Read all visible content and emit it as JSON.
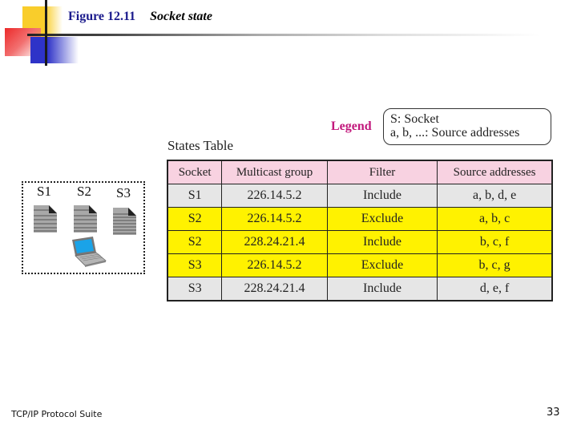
{
  "slide": {
    "figure_number": "Figure 12.11",
    "figure_caption": "Socket state"
  },
  "legend": {
    "label": "Legend",
    "lines": [
      "S: Socket",
      "a, b, ...: Source addresses"
    ]
  },
  "network": {
    "sockets": [
      "S1",
      "S2",
      "S3"
    ],
    "icons": [
      "document-icon",
      "document-icon",
      "document-icon",
      "laptop-icon"
    ]
  },
  "states_table": {
    "title": "States Table",
    "columns": [
      "Socket",
      "Multicast group",
      "Filter",
      "Source addresses"
    ],
    "rows": [
      {
        "socket": "S1",
        "group": "226.14.5.2",
        "filter": "Include",
        "sources": "a, b, d, e",
        "highlight": "gray"
      },
      {
        "socket": "S2",
        "group": "226.14.5.2",
        "filter": "Exclude",
        "sources": "a, b, c",
        "highlight": "yellow"
      },
      {
        "socket": "S2",
        "group": "228.24.21.4",
        "filter": "Include",
        "sources": "b, c, f",
        "highlight": "yellow"
      },
      {
        "socket": "S3",
        "group": "226.14.5.2",
        "filter": "Exclude",
        "sources": "b, c, g",
        "highlight": "yellow"
      },
      {
        "socket": "S3",
        "group": "228.24.21.4",
        "filter": "Include",
        "sources": "d, e, f",
        "highlight": "gray"
      }
    ],
    "colors": {
      "header": "#f8d2e1",
      "gray_row": "#e6e6e6",
      "yellow_row": "#fff200"
    }
  },
  "footer": {
    "left": "TCP/IP Protocol Suite",
    "page_number": "33"
  }
}
